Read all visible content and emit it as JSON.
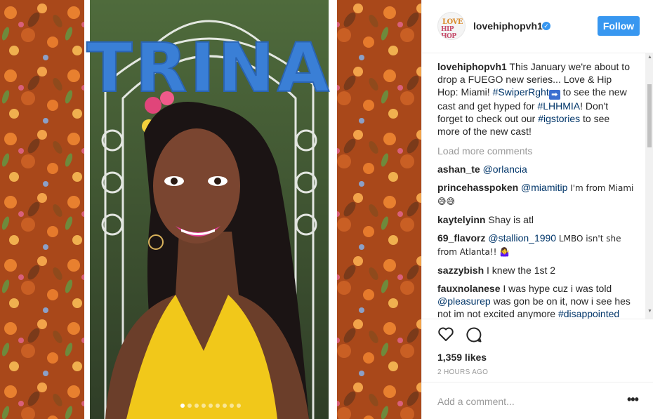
{
  "post": {
    "overlay_text": "TRINA",
    "carousel": {
      "total": 9,
      "active": 0
    }
  },
  "header": {
    "avatar_text_top": "LOVE",
    "avatar_text_bottom": "HIP HOP",
    "username": "lovehiphopvh1",
    "verified_mark": "✓",
    "follow_label": "Follow"
  },
  "caption": {
    "user": "lovehiphopvh1",
    "text1": " This January we're about to drop a FUEGO new series... Love & Hip Hop: Miami! ",
    "tag1": "#SwiperRght",
    "arrow": "➡",
    "text2": " to see the new cast and get hyped for ",
    "tag2": "#LHHMIA",
    "text3": "! Don't forget to check out our ",
    "tag3": "#igstories",
    "text4": " to see more of the new cast!"
  },
  "load_more": "Load more comments",
  "comments": [
    {
      "user": "ashan_te",
      "mention": "@orlancia",
      "text": ""
    },
    {
      "user": "princehasspoken",
      "mention": "@miamitip",
      "text": " I'm from Miami 😅😅"
    },
    {
      "user": "kaytelyinn",
      "mention": "",
      "text": " Shay is atl"
    },
    {
      "user": "69_flavorz",
      "mention": "@stallion_1990",
      "text": " LMBO isn't she from Atlanta!! 🤷‍♀️"
    },
    {
      "user": "sazzybish",
      "mention": "",
      "text": " I knew the 1st 2"
    },
    {
      "user": "fauxnolanese",
      "pre": " I was hype cuz i was told ",
      "mention": "@pleasurep",
      "text": " was gon be on it, now i see hes not im not excited anymore ",
      "tag": "#disappointed"
    }
  ],
  "actions": {
    "likes": "1,359 likes",
    "time": "2 HOURS AGO"
  },
  "add_comment": {
    "placeholder": "Add a comment...",
    "more": "•••"
  },
  "colors": {
    "accent": "#3897f0",
    "hashtag": "#003569",
    "muted": "#999999",
    "overlay": "#3a7fd6"
  }
}
